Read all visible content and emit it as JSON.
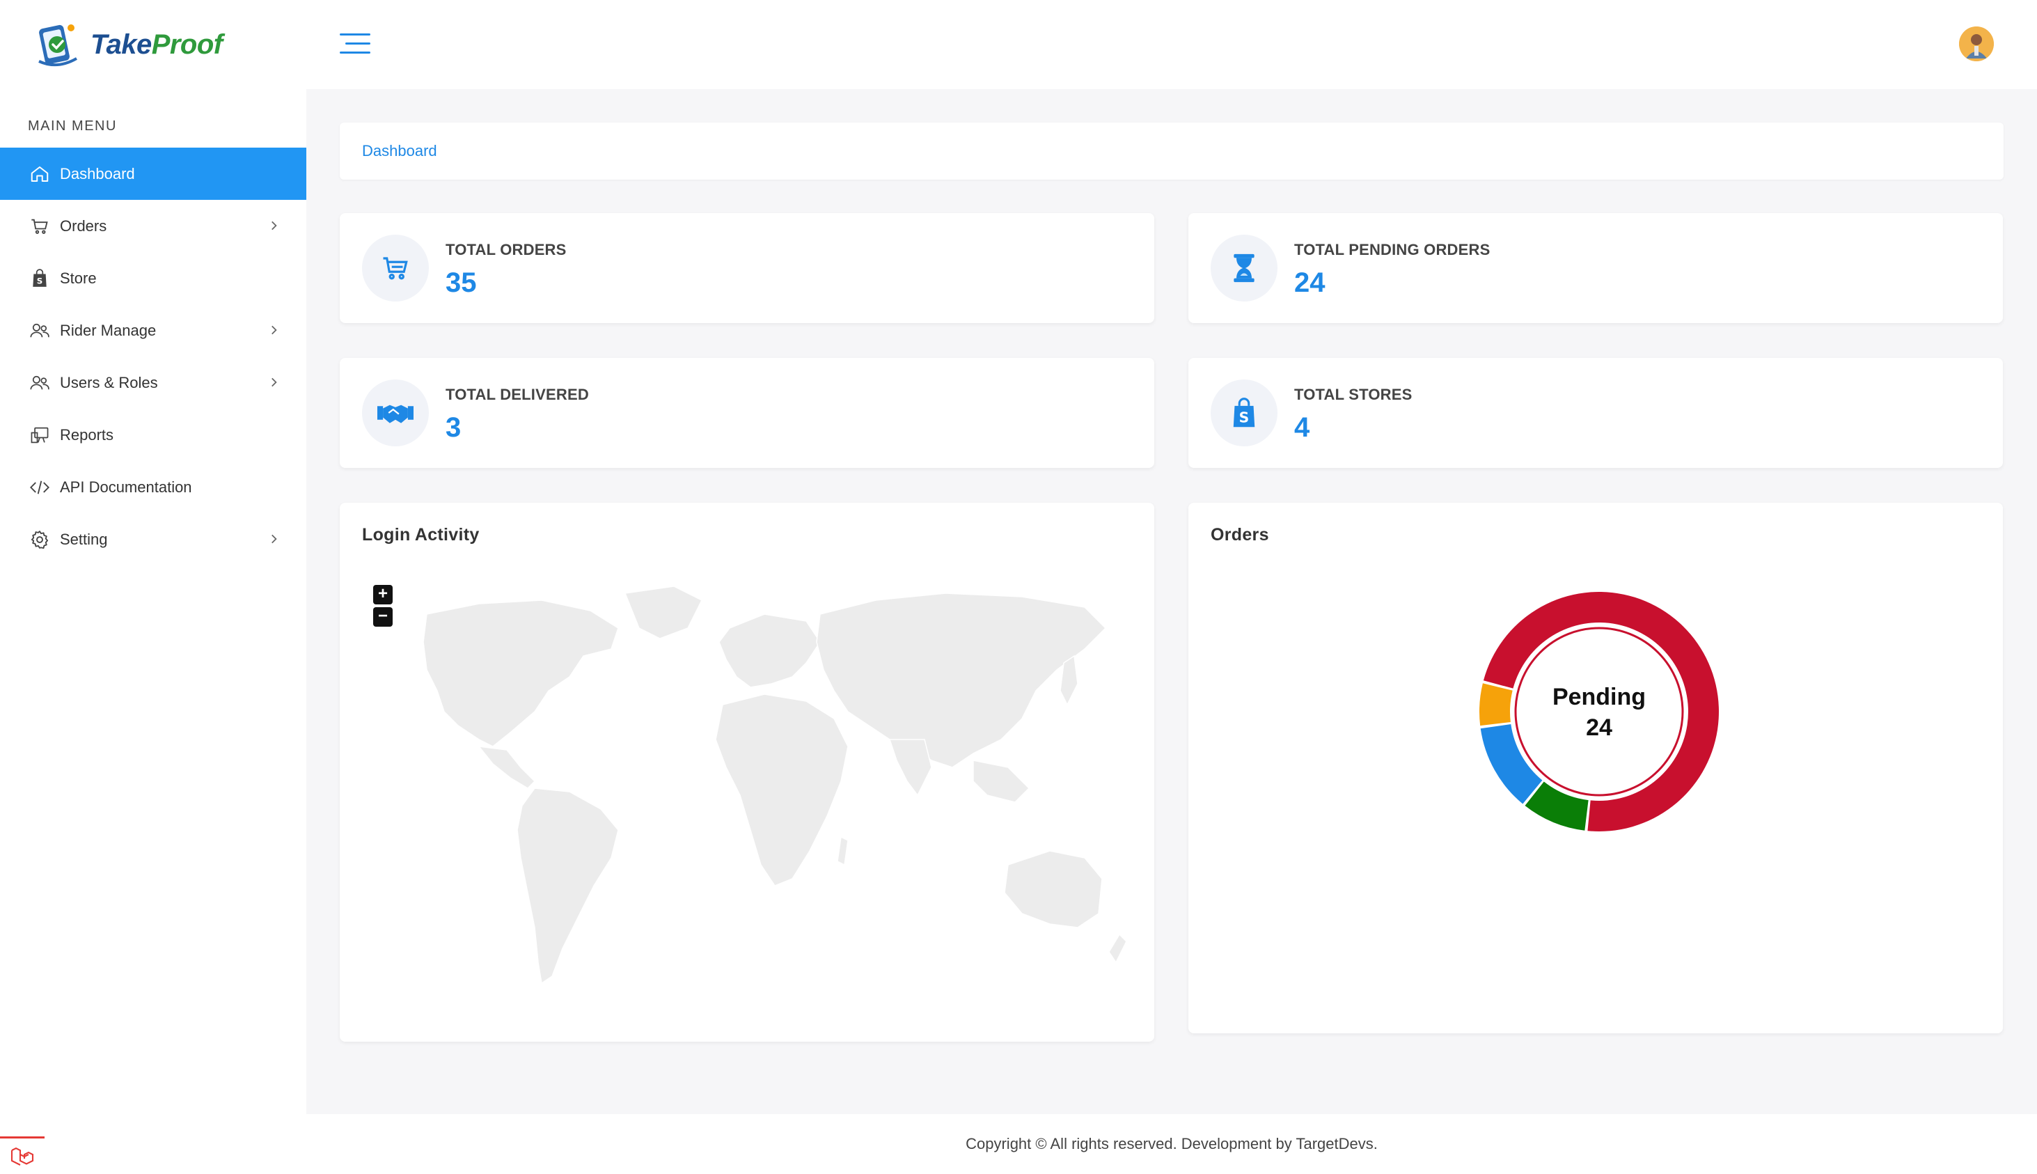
{
  "app": {
    "brand_part1": "Take",
    "brand_part2": "Proof"
  },
  "sidebar": {
    "section_title": "MAIN MENU",
    "items": [
      {
        "label": "Dashboard",
        "icon": "home-icon",
        "active": true,
        "has_children": false
      },
      {
        "label": "Orders",
        "icon": "cart-icon",
        "active": false,
        "has_children": true
      },
      {
        "label": "Store",
        "icon": "shopping-bag-icon",
        "active": false,
        "has_children": false
      },
      {
        "label": "Rider Manage",
        "icon": "users-icon",
        "active": false,
        "has_children": true
      },
      {
        "label": "Users & Roles",
        "icon": "users-icon",
        "active": false,
        "has_children": true
      },
      {
        "label": "Reports",
        "icon": "reports-icon",
        "active": false,
        "has_children": false
      },
      {
        "label": "API Documentation",
        "icon": "code-icon",
        "active": false,
        "has_children": false
      },
      {
        "label": "Setting",
        "icon": "gear-icon",
        "active": false,
        "has_children": true
      }
    ]
  },
  "breadcrumb": {
    "current": "Dashboard"
  },
  "stats": {
    "total_orders": {
      "label": "TOTAL ORDERS",
      "value": "35",
      "icon": "cart-icon"
    },
    "total_pending": {
      "label": "TOTAL PENDING ORDERS",
      "value": "24",
      "icon": "hourglass-icon"
    },
    "total_delivered": {
      "label": "TOTAL DELIVERED",
      "value": "3",
      "icon": "handshake-icon"
    },
    "total_stores": {
      "label": "TOTAL STORES",
      "value": "4",
      "icon": "shopify-bag-icon"
    }
  },
  "login_activity": {
    "title": "Login Activity",
    "zoom_in": "+",
    "zoom_out": "−"
  },
  "orders_chart": {
    "title": "Orders",
    "center_label": "Pending",
    "center_value": "24"
  },
  "chart_data": {
    "type": "pie",
    "title": "Orders",
    "donut": true,
    "center_text": [
      "Pending",
      "24"
    ],
    "slices": [
      {
        "value": 24,
        "color": "#c8102e"
      },
      {
        "value": 3,
        "color": "#0a7e07"
      },
      {
        "value": 4,
        "color": "#1e88e5"
      },
      {
        "value": 2,
        "color": "#f6a20a"
      }
    ]
  },
  "colors": {
    "accent": "#2196f3",
    "stat_value": "#1e88e5",
    "background": "#f6f6f8"
  },
  "footer": {
    "text": "Copyright © All rights reserved. Development by TargetDevs."
  }
}
